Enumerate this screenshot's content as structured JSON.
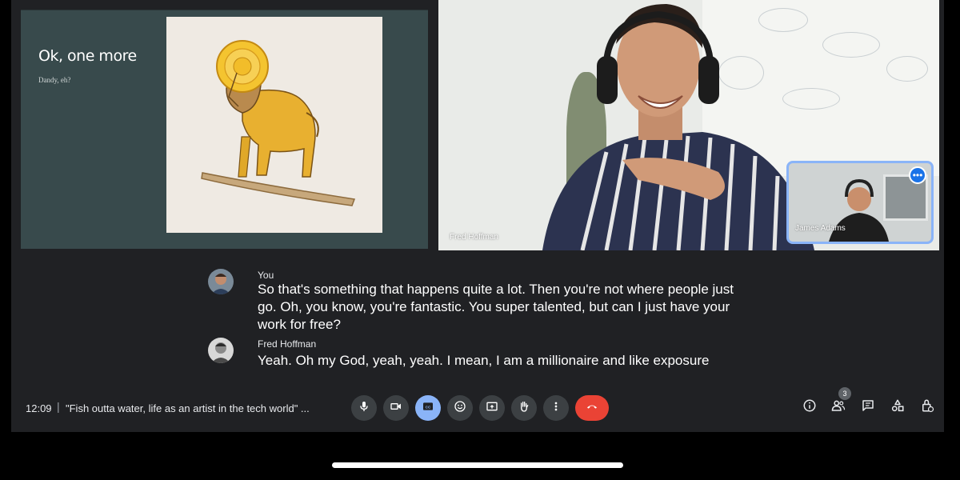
{
  "slide": {
    "title": "Ok, one more",
    "subtitle": "Dandy, eh?"
  },
  "tiles": {
    "main_speaker": "Fred Hoffman",
    "self_view": "James Adams"
  },
  "captions": [
    {
      "speaker": "You",
      "text": "So that's something that happens quite a lot. Then you're not where people just go. Oh, you know, you're fantastic. You super talented, but can I just have your work for free?"
    },
    {
      "speaker": "Fred Hoffman",
      "text": "Yeah. Oh my God, yeah, yeah. I mean, I am a millionaire and like exposure"
    }
  ],
  "bottom_bar": {
    "time": "12:09",
    "separator": "|",
    "meeting_title": "\"Fish outta water, life as an artist in the tech world\" ...",
    "participants_count": "3"
  },
  "colors": {
    "end_call": "#ea4335",
    "captions_active": "#8ab4f8",
    "bar_bg": "#202124"
  },
  "icons": [
    "mic-icon",
    "camera-icon",
    "captions-icon",
    "emoji-icon",
    "present-icon",
    "raise-hand-icon",
    "more-vert-icon",
    "end-call-icon",
    "info-icon",
    "people-icon",
    "chat-icon",
    "activities-icon",
    "host-controls-icon"
  ]
}
